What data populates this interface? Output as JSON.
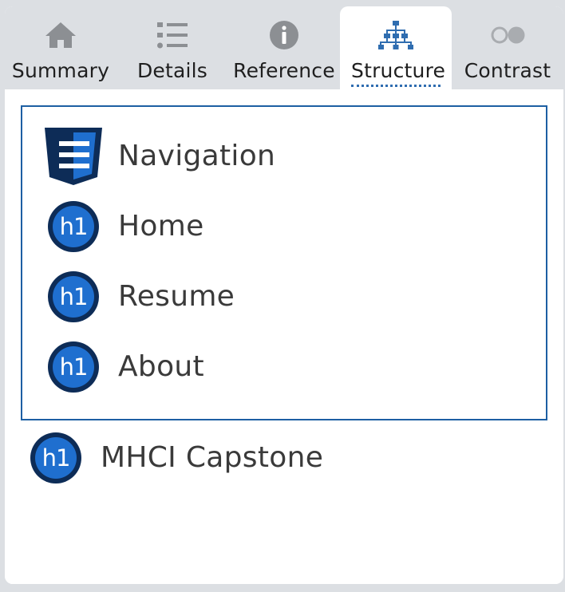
{
  "tabs": [
    {
      "id": "summary",
      "label": "Summary",
      "icon": "home-icon"
    },
    {
      "id": "details",
      "label": "Details",
      "icon": "list-icon"
    },
    {
      "id": "reference",
      "label": "Reference",
      "icon": "info-icon"
    },
    {
      "id": "structure",
      "label": "Structure",
      "icon": "hierarchy-icon",
      "active": true
    },
    {
      "id": "contrast",
      "label": "Contrast",
      "icon": "contrast-icon"
    }
  ],
  "structure": {
    "landmark": {
      "type_icon": "navigation-landmark-icon",
      "label": "Navigation",
      "headings": [
        {
          "level": "h1",
          "label": "Home"
        },
        {
          "level": "h1",
          "label": "Resume"
        },
        {
          "level": "h1",
          "label": "About"
        }
      ]
    },
    "outside_headings": [
      {
        "level": "h1",
        "label": "MHCI Capstone"
      }
    ]
  },
  "colors": {
    "accent": "#1d5fa3",
    "badge_dark": "#0d2c57",
    "badge_light": "#1f6fcf",
    "tab_inactive_icon": "#8c8f93",
    "active_icon": "#2f6db0"
  }
}
